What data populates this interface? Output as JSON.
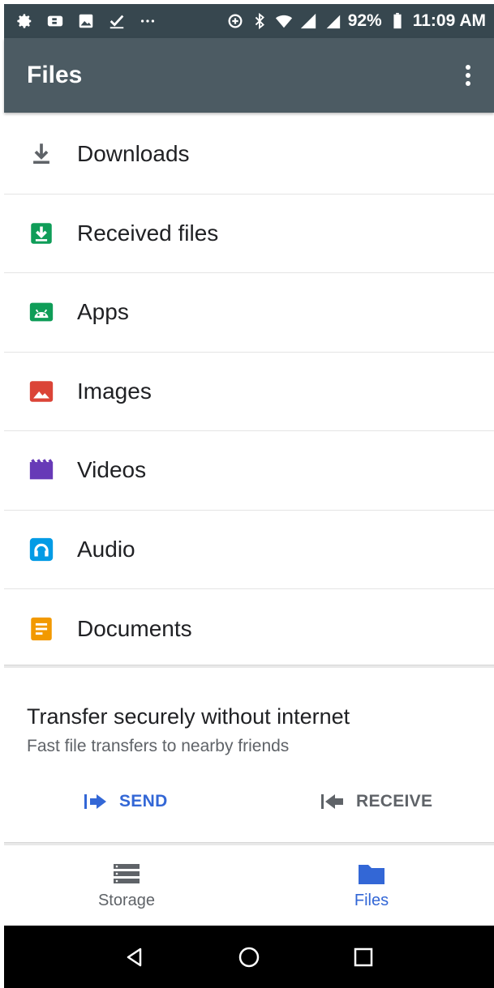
{
  "status_bar": {
    "battery": "92%",
    "time": "11:09 AM",
    "left_icons": [
      "settings-icon",
      "bbm-icon",
      "image-icon",
      "checkmark-icon",
      "more-dots-icon"
    ],
    "right_icons": [
      "data-saver-icon",
      "bluetooth-icon",
      "wifi-icon",
      "signal-icon",
      "signal-icon",
      "battery-icon"
    ]
  },
  "app_bar": {
    "title": "Files",
    "menu_icon": "more-vert-icon"
  },
  "file_list": [
    {
      "label": "Downloads",
      "icon": "download-icon",
      "color": "#5f6368"
    },
    {
      "label": "Received files",
      "icon": "received-files-icon",
      "color": "#0f9d58"
    },
    {
      "label": "Apps",
      "icon": "android-icon",
      "color": "#0f9d58"
    },
    {
      "label": "Images",
      "icon": "image-icon",
      "color": "#db4437"
    },
    {
      "label": "Videos",
      "icon": "video-icon",
      "color": "#673ab7"
    },
    {
      "label": "Audio",
      "icon": "headphones-icon",
      "color": "#039be5"
    },
    {
      "label": "Documents",
      "icon": "document-icon",
      "color": "#f29900"
    }
  ],
  "transfer": {
    "title": "Transfer securely without internet",
    "subtitle": "Fast file transfers to nearby friends",
    "send_label": "SEND",
    "receive_label": "RECEIVE"
  },
  "bottom_nav": [
    {
      "label": "Storage",
      "icon": "storage-icon",
      "active": false
    },
    {
      "label": "Files",
      "icon": "folder-icon",
      "active": true
    }
  ],
  "system_nav": [
    "back-icon",
    "home-icon",
    "recents-icon"
  ],
  "colors": {
    "app_bar": "#4c5b63",
    "status_bar": "#37474f",
    "accent": "#3367d6"
  }
}
